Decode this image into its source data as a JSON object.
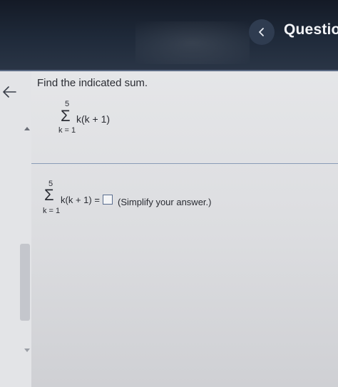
{
  "header": {
    "title": "Questior",
    "back_icon": "chevron-left-icon"
  },
  "nav": {
    "back_icon": "arrow-left-icon"
  },
  "question": {
    "prompt": "Find the indicated sum.",
    "sum": {
      "symbol": "Σ",
      "upper": "5",
      "lower": "k = 1",
      "expression": "k(k + 1)"
    }
  },
  "answer": {
    "sum": {
      "symbol": "Σ",
      "upper": "5",
      "lower": "k = 1",
      "expression": "k(k + 1) ="
    },
    "input_value": "",
    "hint": "(Simplify your answer.)"
  },
  "scrollbar": {
    "up_icon": "caret-up-icon",
    "down_icon": "caret-down-icon"
  }
}
